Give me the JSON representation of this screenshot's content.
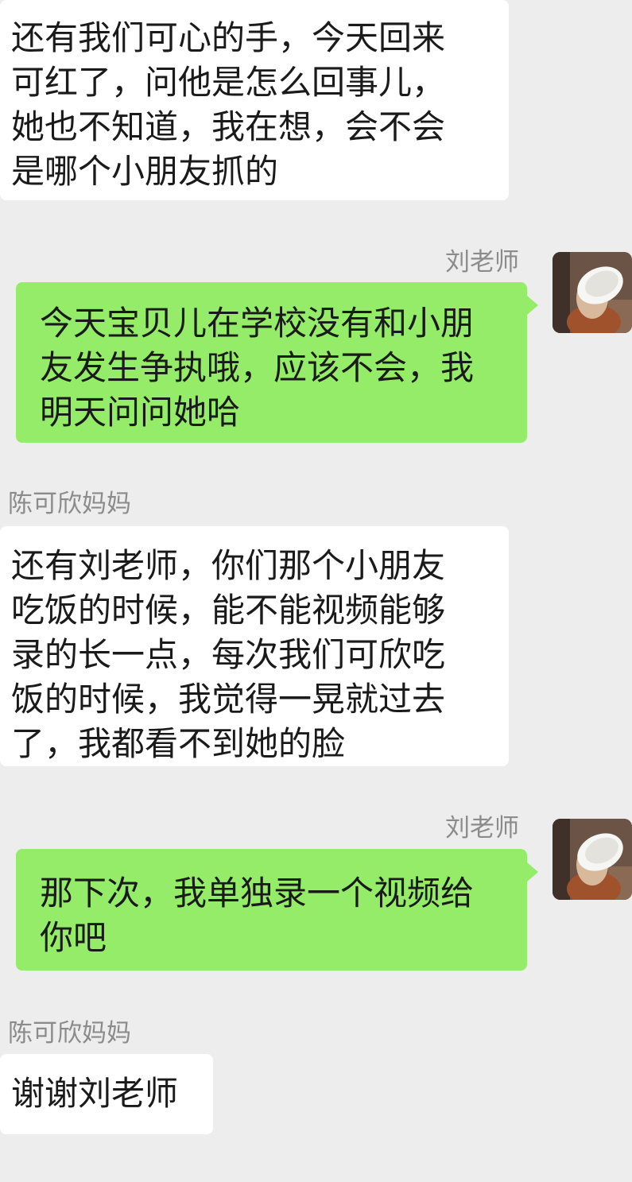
{
  "chat": {
    "messages": [
      {
        "side": "left",
        "text": "还有我们可心的手，今天回来\n可红了，问他是怎么回事儿，\n她也不知道，我在想，会不会\n是哪个小朋友抓的"
      },
      {
        "side": "right",
        "sender": "刘老师",
        "avatar_icon": "teacher-avatar-photo",
        "text": "今天宝贝儿在学校没有和小朋\n友发生争执哦，应该不会，我\n明天问问她哈"
      },
      {
        "side": "left",
        "sender": "陈可欣妈妈",
        "text": "还有刘老师，你们那个小朋友\n吃饭的时候，能不能视频能够\n录的长一点，每次我们可欣吃\n饭的时候，我觉得一晃就过去\n了，我都看不到她的脸"
      },
      {
        "side": "right",
        "sender": "刘老师",
        "avatar_icon": "teacher-avatar-photo",
        "text": "那下次，我单独录一个视频给\n你吧"
      },
      {
        "side": "left",
        "sender": "陈可欣妈妈",
        "text": "谢谢刘老师"
      }
    ]
  },
  "colors": {
    "background": "#ededed",
    "incoming_bubble": "#ffffff",
    "outgoing_bubble": "#95ec69",
    "sender_name": "#8b8b8b",
    "message_text": "#1a1a1a"
  }
}
